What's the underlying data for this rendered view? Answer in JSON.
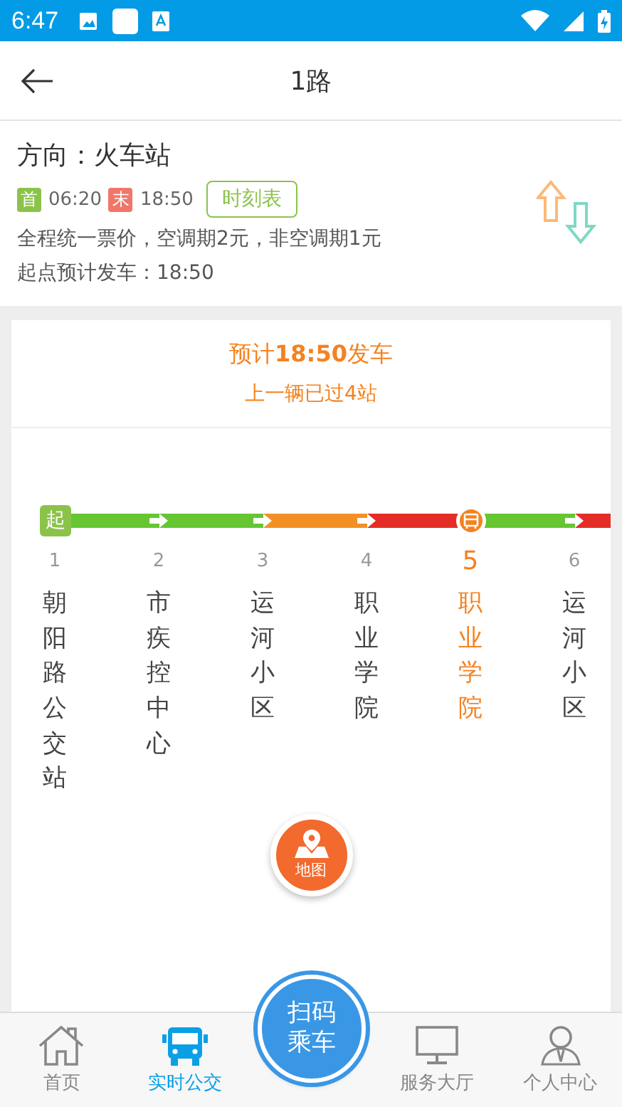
{
  "status_bar": {
    "time": "6:47"
  },
  "header": {
    "title": "1路"
  },
  "route_info": {
    "direction": "方向：火车站",
    "first_label": "首",
    "first_time": "06:20",
    "last_label": "末",
    "last_time": "18:50",
    "timetable_button": "时刻表",
    "fare": "全程统一票价，空调期2元，非空调期1元",
    "departure": "起点预计发车：18:50"
  },
  "arrival": {
    "prefix": "预计",
    "time": "18:50",
    "suffix": "发车",
    "previous": "上一辆已过4站"
  },
  "line": {
    "start_badge": "起",
    "stations": [
      {
        "number": "1",
        "name": "朝阳路公交站",
        "selected": false,
        "bus": false,
        "color": "#66c631"
      },
      {
        "number": "2",
        "name": "市疾控中心",
        "selected": false,
        "bus": false,
        "color": "#66c631"
      },
      {
        "number": "3",
        "name": "运河小区",
        "selected": false,
        "bus": false,
        "color": "#f39025"
      },
      {
        "number": "4",
        "name": "职业学院",
        "selected": false,
        "bus": false,
        "color": "#e52d27"
      },
      {
        "number": "5",
        "name": "职业学院",
        "selected": true,
        "bus": true,
        "color": "#66c631"
      },
      {
        "number": "6",
        "name": "运河小区",
        "selected": false,
        "bus": false,
        "color": "#e52d27"
      }
    ]
  },
  "map_button": {
    "label": "地图"
  },
  "scan_button": {
    "label": "扫码乘车"
  },
  "nav": [
    {
      "label": "首页",
      "kind": "home",
      "selected": false
    },
    {
      "label": "实时公交",
      "kind": "bus",
      "selected": true
    },
    {
      "label": "服务大厅",
      "kind": "monitor",
      "selected": false
    },
    {
      "label": "个人中心",
      "kind": "person",
      "selected": false
    }
  ]
}
